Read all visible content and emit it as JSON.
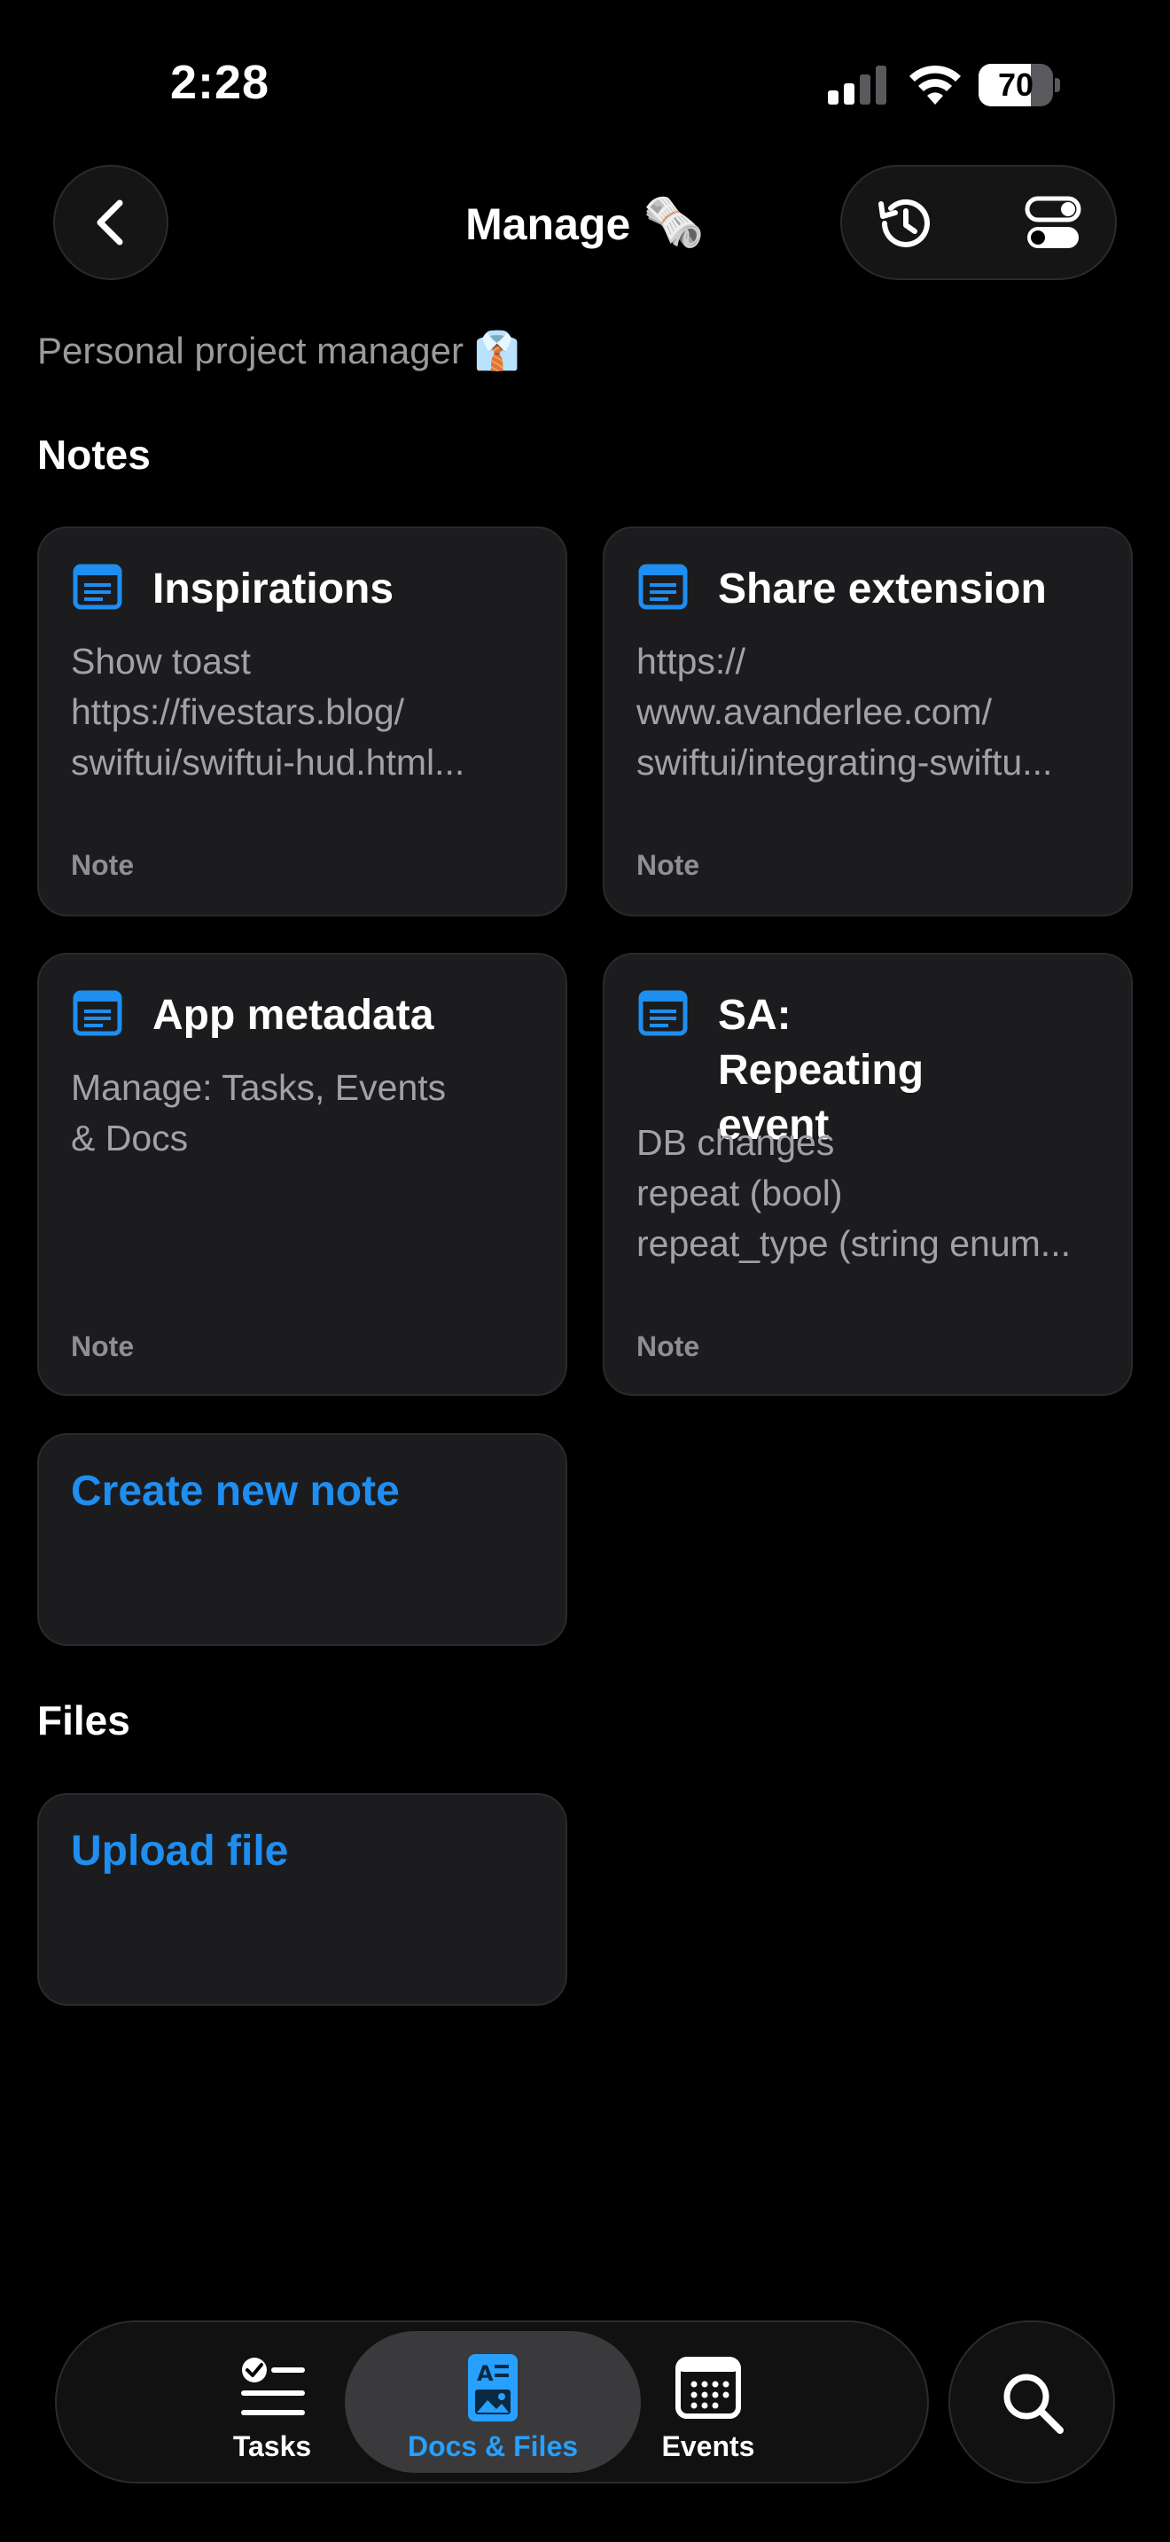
{
  "status_bar": {
    "time": "2:28",
    "battery": "70"
  },
  "header": {
    "title": "Manage",
    "title_emoji": "🗞️"
  },
  "subtitle": "Personal project manager 👔",
  "sections": {
    "notes_title": "Notes",
    "files_title": "Files"
  },
  "notes": [
    {
      "title": "Inspirations",
      "lines": [
        "Show toast",
        "https://fivestars.blog/",
        "swiftui/swiftui-hud.html..."
      ],
      "tag": "Note"
    },
    {
      "title": "Share extension",
      "lines": [
        "https://",
        "www.avanderlee.com/",
        "swiftui/integrating-swiftu..."
      ],
      "tag": "Note"
    },
    {
      "title": "App metadata",
      "lines": [
        "Manage: Tasks, Events",
        "& Docs"
      ],
      "tag": "Note"
    },
    {
      "title": "SA: Repeating event",
      "lines": [
        "DB changes",
        "repeat (bool)",
        "repeat_type (string enum..."
      ],
      "tag": "Note"
    }
  ],
  "create_note_label": "Create new note",
  "upload_file_label": "Upload file",
  "tabbar": {
    "tabs": [
      {
        "label": "Tasks",
        "icon": "checklist-icon",
        "active": false
      },
      {
        "label": "Docs & Files",
        "icon": "docs-icon",
        "active": true
      },
      {
        "label": "Events",
        "icon": "calendar-icon",
        "active": false
      }
    ],
    "search_icon": "search-icon"
  },
  "colors": {
    "accent": "#1e8ef0",
    "card_bg": "#1c1c1e",
    "background": "#000000"
  }
}
